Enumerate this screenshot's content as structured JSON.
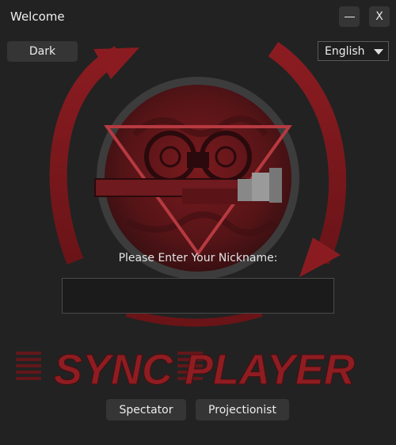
{
  "window": {
    "title": "Welcome",
    "minimize_label": "–",
    "close_label": "X"
  },
  "controls": {
    "theme_label": "Dark",
    "language_selected": "English"
  },
  "nickname": {
    "prompt": "Please Enter Your Nickname:",
    "value": ""
  },
  "brand": {
    "wordmark": "SYNC PLAYER"
  },
  "roles": {
    "spectator_label": "Spectator",
    "projectionist_label": "Projectionist"
  },
  "colors": {
    "background": "#222222",
    "button": "#353535",
    "brand_red": "#8e1d22"
  },
  "icons": {
    "logo": "film-projector-sync-logo",
    "dropdown": "chevron-down-icon"
  }
}
